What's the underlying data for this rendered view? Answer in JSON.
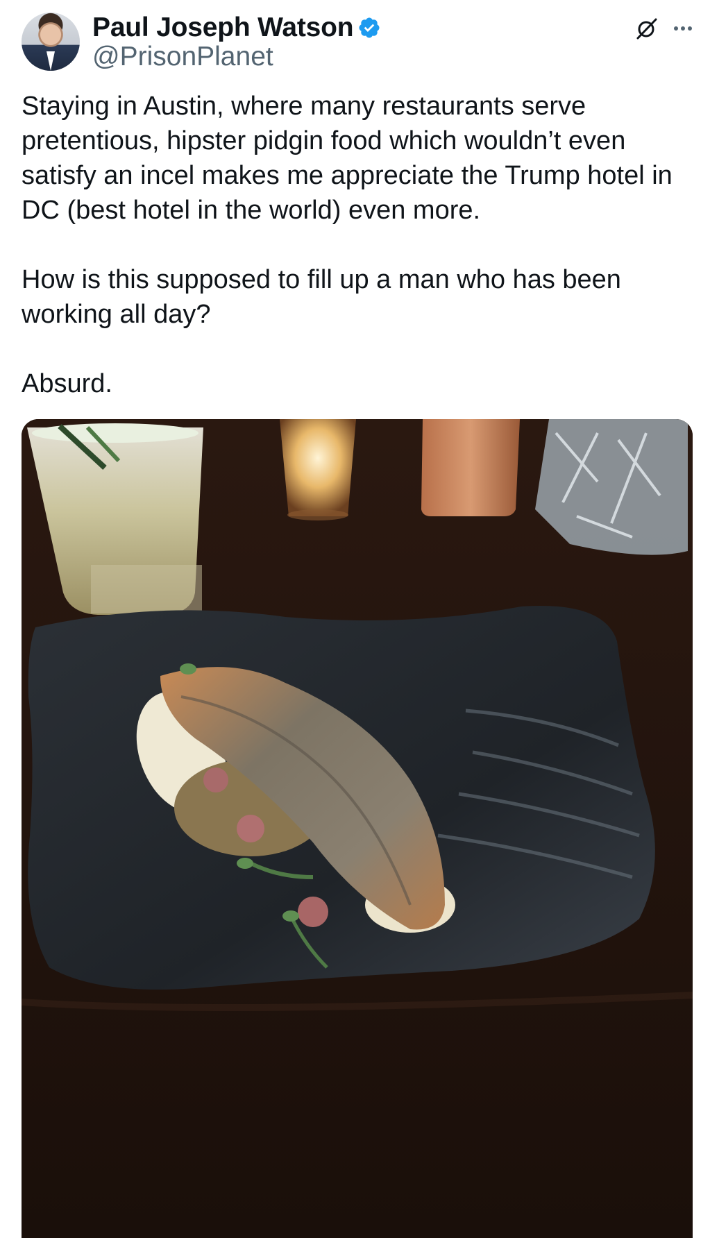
{
  "tweet": {
    "author": {
      "display_name": "Paul Joseph Watson",
      "handle": "@PrisonPlanet",
      "verified": true,
      "verified_color": "#1d9bf0"
    },
    "icons": {
      "verified": "verified-badge-icon",
      "grok": "grok-icon",
      "more": "more-options-icon"
    },
    "text": {
      "p1": "Staying in Austin, where many restaurants serve pretentious, hipster pidgin food which wouldn’t even satisfy an incel makes me appreciate the Trump hotel in DC (best hotel in the world) even more.",
      "p2": "How is this supposed to fill up a man who has been working all day?",
      "p3": "Absurd."
    },
    "colors": {
      "text": "#0f1419",
      "secondary": "#536471"
    }
  }
}
